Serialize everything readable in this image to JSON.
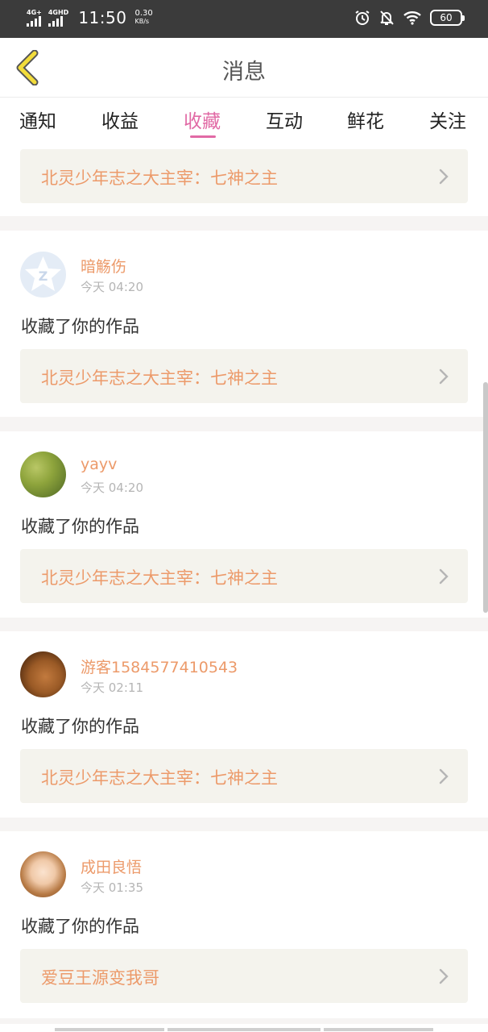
{
  "status_bar": {
    "network1": "4G+",
    "network2": "4GHD",
    "time": "11:50",
    "speed_value": "0.30",
    "speed_unit": "KB/s",
    "battery": "60"
  },
  "header": {
    "title": "消息"
  },
  "tabs": [
    "通知",
    "收益",
    "收藏",
    "互动",
    "鲜花",
    "关注"
  ],
  "active_tab": "收藏",
  "top_partial": {
    "work_title": "北灵少年志之大主宰：七神之主"
  },
  "messages": [
    {
      "username": "暗觞伤",
      "time": "今天 04:20",
      "action": "收藏了你的作品",
      "work_title": "北灵少年志之大主宰：七神之主",
      "avatar": "default-avatar-icon"
    },
    {
      "username": "yayv",
      "time": "今天 04:20",
      "action": "收藏了你的作品",
      "work_title": "北灵少年志之大主宰：七神之主",
      "avatar": "grass-photo-avatar"
    },
    {
      "username": "游客1584577410543",
      "time": "今天 02:11",
      "action": "收藏了你的作品",
      "work_title": "北灵少年志之大主宰：七神之主",
      "avatar": "dog-photo-avatar"
    },
    {
      "username": "成田良悟",
      "time": "今天 01:35",
      "action": "收藏了你的作品",
      "work_title": "爱豆王源变我哥",
      "avatar": "anime-girl-avatar"
    }
  ],
  "colors": {
    "accent": "#e16aa5",
    "username": "#ec9a6a",
    "work_box_bg": "#f4f3ed",
    "status_bar_bg": "#3b3b3b"
  }
}
